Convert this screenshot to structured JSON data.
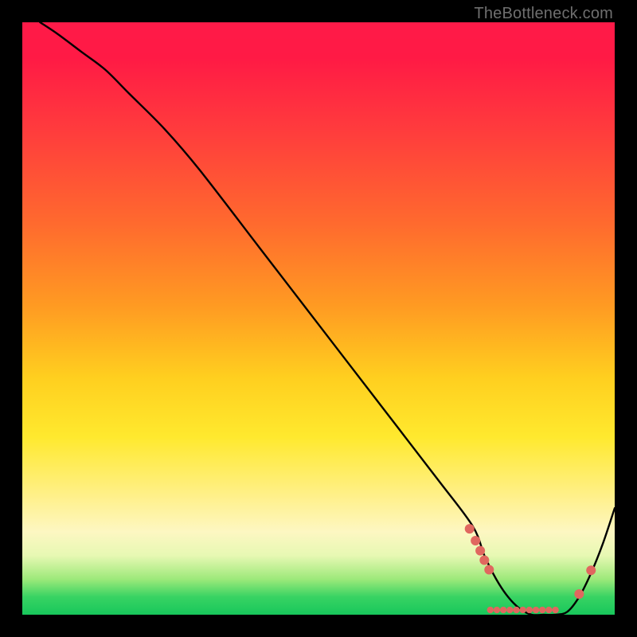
{
  "watermark": "TheBottleneck.com",
  "chart_data": {
    "type": "line",
    "title": "",
    "xlabel": "",
    "ylabel": "",
    "xlim": [
      0,
      100
    ],
    "ylim": [
      0,
      100
    ],
    "series": [
      {
        "name": "curve",
        "x": [
          3,
          6,
          10,
          14,
          18,
          24,
          30,
          40,
          50,
          60,
          70,
          76,
          78,
          80,
          82,
          84,
          86,
          88,
          90,
          92,
          94,
          96,
          98,
          100
        ],
        "y": [
          100,
          98,
          95,
          92,
          88,
          82,
          75,
          62,
          49,
          36,
          23,
          15,
          10,
          6,
          3,
          1,
          0,
          0,
          0,
          0.5,
          3,
          7,
          12,
          18
        ]
      }
    ],
    "markers": {
      "name": "highlight-dots",
      "color": "#e0675f",
      "points": [
        {
          "x": 75.5,
          "y": 14.5,
          "r": 6
        },
        {
          "x": 76.5,
          "y": 12.5,
          "r": 6
        },
        {
          "x": 77.3,
          "y": 10.8,
          "r": 6
        },
        {
          "x": 78.0,
          "y": 9.2,
          "r": 6
        },
        {
          "x": 78.8,
          "y": 7.6,
          "r": 6
        },
        {
          "x": 79.0,
          "y": 0.8,
          "r": 4.2
        },
        {
          "x": 80.1,
          "y": 0.8,
          "r": 4.2
        },
        {
          "x": 81.2,
          "y": 0.8,
          "r": 4.2
        },
        {
          "x": 82.3,
          "y": 0.8,
          "r": 4.2
        },
        {
          "x": 83.4,
          "y": 0.8,
          "r": 4.2
        },
        {
          "x": 84.5,
          "y": 0.8,
          "r": 4.2
        },
        {
          "x": 85.6,
          "y": 0.8,
          "r": 4.2
        },
        {
          "x": 86.7,
          "y": 0.8,
          "r": 4.2
        },
        {
          "x": 87.8,
          "y": 0.8,
          "r": 4.2
        },
        {
          "x": 88.9,
          "y": 0.8,
          "r": 4.2
        },
        {
          "x": 90.0,
          "y": 0.8,
          "r": 4.2
        },
        {
          "x": 94.0,
          "y": 3.5,
          "r": 6
        },
        {
          "x": 96.0,
          "y": 7.5,
          "r": 6
        }
      ]
    }
  }
}
